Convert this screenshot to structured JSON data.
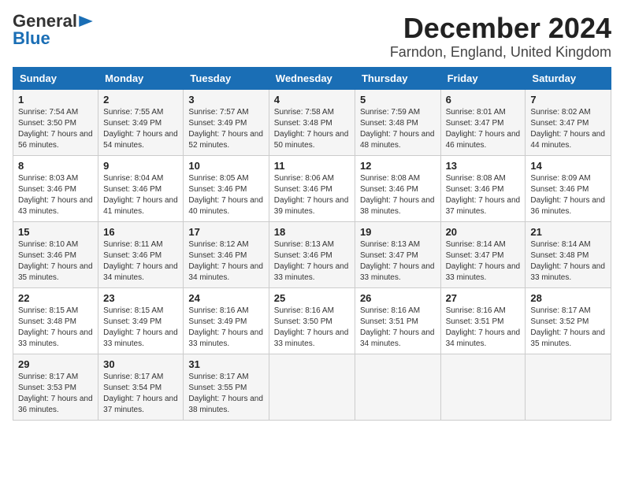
{
  "header": {
    "logo_general": "General",
    "logo_blue": "Blue",
    "title": "December 2024",
    "subtitle": "Farndon, England, United Kingdom"
  },
  "calendar": {
    "days_of_week": [
      "Sunday",
      "Monday",
      "Tuesday",
      "Wednesday",
      "Thursday",
      "Friday",
      "Saturday"
    ],
    "weeks": [
      [
        {
          "day": "1",
          "sunrise": "7:54 AM",
          "sunset": "3:50 PM",
          "daylight": "7 hours and 56 minutes."
        },
        {
          "day": "2",
          "sunrise": "7:55 AM",
          "sunset": "3:49 PM",
          "daylight": "7 hours and 54 minutes."
        },
        {
          "day": "3",
          "sunrise": "7:57 AM",
          "sunset": "3:49 PM",
          "daylight": "7 hours and 52 minutes."
        },
        {
          "day": "4",
          "sunrise": "7:58 AM",
          "sunset": "3:48 PM",
          "daylight": "7 hours and 50 minutes."
        },
        {
          "day": "5",
          "sunrise": "7:59 AM",
          "sunset": "3:48 PM",
          "daylight": "7 hours and 48 minutes."
        },
        {
          "day": "6",
          "sunrise": "8:01 AM",
          "sunset": "3:47 PM",
          "daylight": "7 hours and 46 minutes."
        },
        {
          "day": "7",
          "sunrise": "8:02 AM",
          "sunset": "3:47 PM",
          "daylight": "7 hours and 44 minutes."
        }
      ],
      [
        {
          "day": "8",
          "sunrise": "8:03 AM",
          "sunset": "3:46 PM",
          "daylight": "7 hours and 43 minutes."
        },
        {
          "day": "9",
          "sunrise": "8:04 AM",
          "sunset": "3:46 PM",
          "daylight": "7 hours and 41 minutes."
        },
        {
          "day": "10",
          "sunrise": "8:05 AM",
          "sunset": "3:46 PM",
          "daylight": "7 hours and 40 minutes."
        },
        {
          "day": "11",
          "sunrise": "8:06 AM",
          "sunset": "3:46 PM",
          "daylight": "7 hours and 39 minutes."
        },
        {
          "day": "12",
          "sunrise": "8:08 AM",
          "sunset": "3:46 PM",
          "daylight": "7 hours and 38 minutes."
        },
        {
          "day": "13",
          "sunrise": "8:08 AM",
          "sunset": "3:46 PM",
          "daylight": "7 hours and 37 minutes."
        },
        {
          "day": "14",
          "sunrise": "8:09 AM",
          "sunset": "3:46 PM",
          "daylight": "7 hours and 36 minutes."
        }
      ],
      [
        {
          "day": "15",
          "sunrise": "8:10 AM",
          "sunset": "3:46 PM",
          "daylight": "7 hours and 35 minutes."
        },
        {
          "day": "16",
          "sunrise": "8:11 AM",
          "sunset": "3:46 PM",
          "daylight": "7 hours and 34 minutes."
        },
        {
          "day": "17",
          "sunrise": "8:12 AM",
          "sunset": "3:46 PM",
          "daylight": "7 hours and 34 minutes."
        },
        {
          "day": "18",
          "sunrise": "8:13 AM",
          "sunset": "3:46 PM",
          "daylight": "7 hours and 33 minutes."
        },
        {
          "day": "19",
          "sunrise": "8:13 AM",
          "sunset": "3:47 PM",
          "daylight": "7 hours and 33 minutes."
        },
        {
          "day": "20",
          "sunrise": "8:14 AM",
          "sunset": "3:47 PM",
          "daylight": "7 hours and 33 minutes."
        },
        {
          "day": "21",
          "sunrise": "8:14 AM",
          "sunset": "3:48 PM",
          "daylight": "7 hours and 33 minutes."
        }
      ],
      [
        {
          "day": "22",
          "sunrise": "8:15 AM",
          "sunset": "3:48 PM",
          "daylight": "7 hours and 33 minutes."
        },
        {
          "day": "23",
          "sunrise": "8:15 AM",
          "sunset": "3:49 PM",
          "daylight": "7 hours and 33 minutes."
        },
        {
          "day": "24",
          "sunrise": "8:16 AM",
          "sunset": "3:49 PM",
          "daylight": "7 hours and 33 minutes."
        },
        {
          "day": "25",
          "sunrise": "8:16 AM",
          "sunset": "3:50 PM",
          "daylight": "7 hours and 33 minutes."
        },
        {
          "day": "26",
          "sunrise": "8:16 AM",
          "sunset": "3:51 PM",
          "daylight": "7 hours and 34 minutes."
        },
        {
          "day": "27",
          "sunrise": "8:16 AM",
          "sunset": "3:51 PM",
          "daylight": "7 hours and 34 minutes."
        },
        {
          "day": "28",
          "sunrise": "8:17 AM",
          "sunset": "3:52 PM",
          "daylight": "7 hours and 35 minutes."
        }
      ],
      [
        {
          "day": "29",
          "sunrise": "8:17 AM",
          "sunset": "3:53 PM",
          "daylight": "7 hours and 36 minutes."
        },
        {
          "day": "30",
          "sunrise": "8:17 AM",
          "sunset": "3:54 PM",
          "daylight": "7 hours and 37 minutes."
        },
        {
          "day": "31",
          "sunrise": "8:17 AM",
          "sunset": "3:55 PM",
          "daylight": "7 hours and 38 minutes."
        },
        null,
        null,
        null,
        null
      ]
    ]
  }
}
